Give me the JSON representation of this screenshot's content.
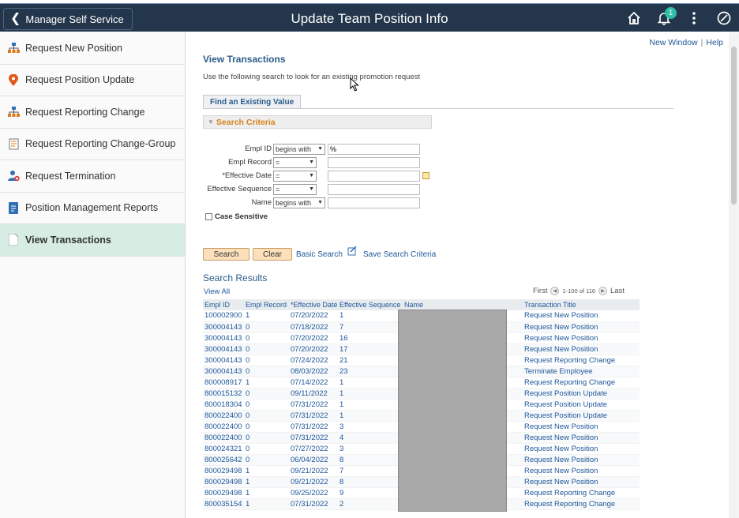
{
  "header": {
    "back_label": "Manager Self Service",
    "title": "Update Team Position Info",
    "notification_count": "1",
    "icons": [
      "home-icon",
      "bell-icon",
      "kebab-menu-icon",
      "navbar-icon"
    ]
  },
  "sidebar": {
    "items": [
      {
        "label": "Request New Position",
        "icon": "org-chart-icon"
      },
      {
        "label": "Request Position Update",
        "icon": "location-pin-icon"
      },
      {
        "label": "Request Reporting Change",
        "icon": "org-chart-icon"
      },
      {
        "label": "Request Reporting Change-Group",
        "icon": "checklist-icon"
      },
      {
        "label": "Request Termination",
        "icon": "user-remove-icon"
      },
      {
        "label": "Position Management  Reports",
        "icon": "report-icon"
      },
      {
        "label": "View Transactions",
        "icon": "document-icon",
        "active": true
      }
    ]
  },
  "links": {
    "new_window": "New Window",
    "help": "Help"
  },
  "page": {
    "title": "View Transactions",
    "description": "Use the following search to look for an existing promotion request",
    "tab": "Find an Existing Value",
    "criteria_header": "Search Criteria"
  },
  "fields": {
    "empl_id": {
      "label": "Empl ID",
      "operator": "begins with",
      "value": "%"
    },
    "empl_record": {
      "label": "Empl Record",
      "operator": "=",
      "value": ""
    },
    "effective_date": {
      "label": "*Effective Date",
      "operator": "=",
      "value": ""
    },
    "effective_sequence": {
      "label": "Effective Sequence",
      "operator": "=",
      "value": ""
    },
    "name": {
      "label": "Name",
      "operator": "begins with",
      "value": ""
    }
  },
  "case_sensitive": {
    "label": "Case Sensitive",
    "checked": false
  },
  "actions": {
    "search": "Search",
    "clear": "Clear",
    "basic_search": "Basic Search",
    "save_criteria": "Save Search Criteria"
  },
  "results": {
    "title": "Search Results",
    "view_all": "View All",
    "first": "First",
    "range": "1-100 of 116",
    "last": "Last",
    "columns": [
      "Empl ID",
      "Empl Record",
      "*Effective Date",
      "Effective Sequence",
      "Name",
      "Transaction Title"
    ],
    "rows": [
      [
        "100002900",
        "1",
        "07/20/2022",
        "1",
        "",
        "Request New Position"
      ],
      [
        "300004143",
        "0",
        "07/18/2022",
        "7",
        "",
        "Request New Position"
      ],
      [
        "300004143",
        "0",
        "07/20/2022",
        "16",
        "",
        "Request New Position"
      ],
      [
        "300004143",
        "0",
        "07/20/2022",
        "17",
        "",
        "Request New Position"
      ],
      [
        "300004143",
        "0",
        "07/24/2022",
        "21",
        "",
        "Request Reporting Change"
      ],
      [
        "300004143",
        "0",
        "08/03/2022",
        "23",
        "",
        "Terminate Employee"
      ],
      [
        "800008917",
        "1",
        "07/14/2022",
        "1",
        "",
        "Request Reporting Change"
      ],
      [
        "800015132",
        "0",
        "09/11/2022",
        "1",
        "",
        "Request Position Update"
      ],
      [
        "800018304",
        "0",
        "07/31/2022",
        "1",
        "",
        "Request Position Update"
      ],
      [
        "800022400",
        "0",
        "07/31/2022",
        "1",
        "",
        "Request Position Update"
      ],
      [
        "800022400",
        "0",
        "07/31/2022",
        "3",
        "",
        "Request New Position"
      ],
      [
        "800022400",
        "0",
        "07/31/2022",
        "4",
        "",
        "Request New Position"
      ],
      [
        "800024321",
        "0",
        "07/27/2022",
        "3",
        "",
        "Request New Position"
      ],
      [
        "800025642",
        "0",
        "06/04/2022",
        "8",
        "",
        "Request New Position"
      ],
      [
        "800029498",
        "1",
        "09/21/2022",
        "7",
        "",
        "Request New Position"
      ],
      [
        "800029498",
        "1",
        "09/21/2022",
        "8",
        "",
        "Request New Position"
      ],
      [
        "800029498",
        "1",
        "09/25/2022",
        "9",
        "",
        "Request Reporting Change"
      ],
      [
        "800035154",
        "1",
        "07/31/2022",
        "2",
        "",
        "Request Reporting Change"
      ]
    ]
  },
  "colors": {
    "header_bg": "#23364b",
    "active_item_bg": "#d7ece3",
    "link": "#1e5799",
    "criteria_header": "#d9821b",
    "button_bg": "#fbe0bb"
  }
}
